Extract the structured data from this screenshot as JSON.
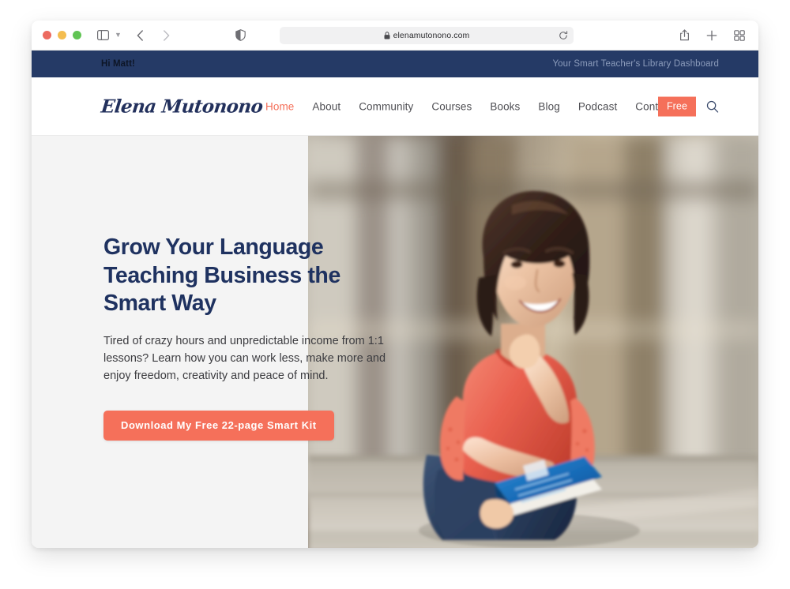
{
  "browser": {
    "url": "elenamutonono.com",
    "lock_icon": "lock-icon",
    "reload_icon": "reload-icon",
    "shield_icon": "privacy-shield-icon",
    "sidebar_icon": "sidebar-toggle-icon",
    "back_icon": "back-arrow-icon",
    "forward_icon": "forward-arrow-icon",
    "share_icon": "share-icon",
    "new_tab_icon": "plus-icon",
    "tab_overview_icon": "tab-overview-icon"
  },
  "announcement": {
    "greeting": "Hi Matt!",
    "tagline": "Your Smart Teacher's Library Dashboard"
  },
  "header": {
    "logo_text": "Elena Mutonono",
    "nav": [
      {
        "label": "Home",
        "active": true
      },
      {
        "label": "About",
        "active": false
      },
      {
        "label": "Community",
        "active": false
      },
      {
        "label": "Courses",
        "active": false
      },
      {
        "label": "Books",
        "active": false
      },
      {
        "label": "Blog",
        "active": false
      },
      {
        "label": "Podcast",
        "active": false
      },
      {
        "label": "Contact",
        "active": false
      }
    ],
    "free_button": "Free",
    "search_icon": "search-icon"
  },
  "hero": {
    "title": "Grow Your Language Teaching Business the Smart Way",
    "subtitle": "Tired of crazy hours and unpredictable income from 1:1 lessons? Learn how you can work less, make more and enjoy freedom, creativity and peace of mind.",
    "cta_label": "Download My Free 22-page Smart Kit",
    "photo_alt": "smiling-woman-holding-blue-book"
  },
  "colors": {
    "navy_bar": "#253a66",
    "heading_navy": "#1f3260",
    "coral_accent": "#f5705a",
    "hero_background": "#f4f4f4",
    "announce_tagline": "#8c9cbb"
  }
}
